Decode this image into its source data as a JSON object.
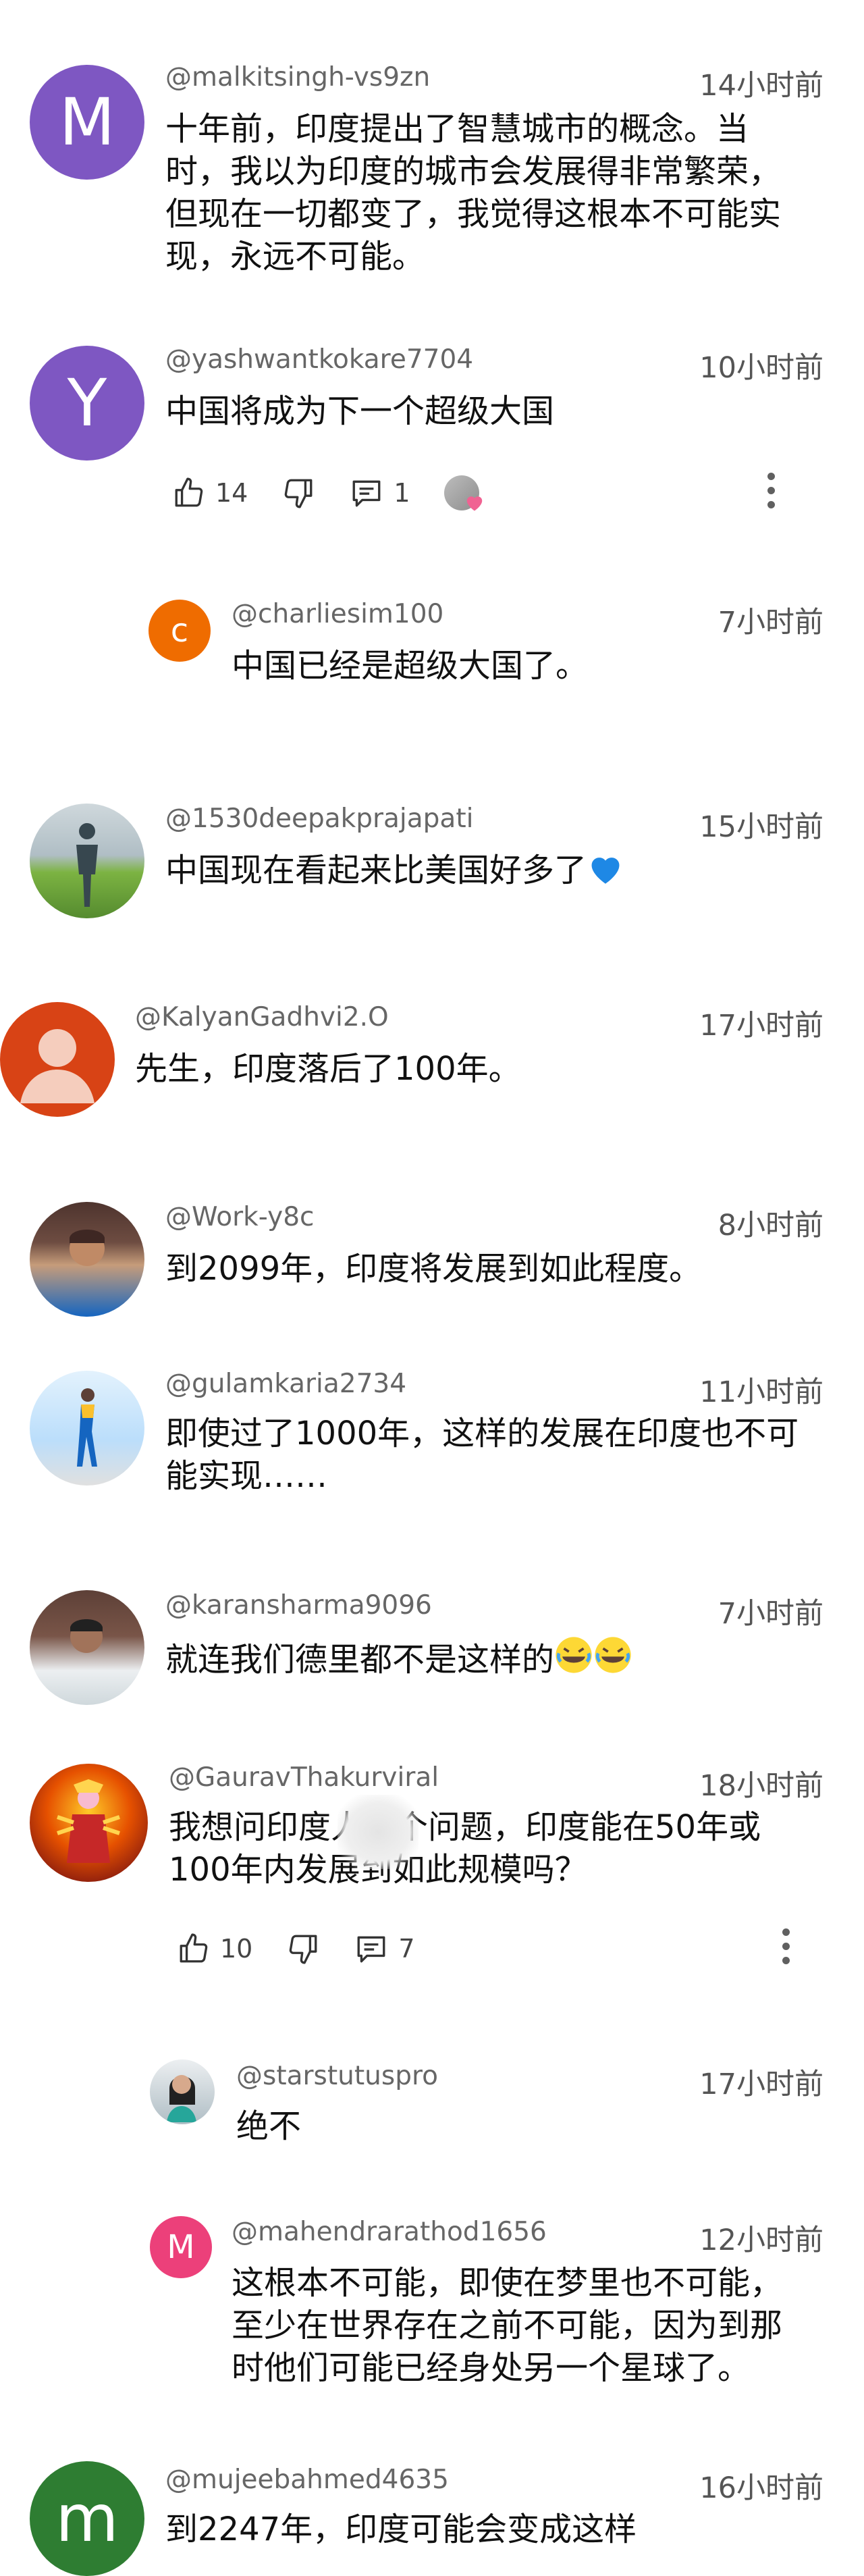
{
  "comments": [
    {
      "handle": "@malkitsingh-vs9zn",
      "time": "14小时前",
      "avatar_letter": "M",
      "avatar_color": "#7e57c2",
      "lines": [
        "十年前，印度提出了智慧城市的概念。当",
        "时，我以为印度的城市会发展得非常繁荣，",
        "但现在一切都变了，我觉得这根本不可能实",
        "现，永远不可能。"
      ]
    },
    {
      "handle": "@yashwantkokare7704",
      "time": "10小时前",
      "avatar_letter": "Y",
      "avatar_color": "#7e57c2",
      "lines": [
        "中国将成为下一个超级大国"
      ],
      "likes": "14",
      "replies": "1"
    },
    {
      "handle": "@charliesim100",
      "time": "7小时前",
      "avatar_letter": "c",
      "avatar_color": "#ef6c00",
      "lines": [
        "中国已经是超级大国了。"
      ]
    },
    {
      "handle": "@1530deepakprajapati",
      "time": "15小时前",
      "lines": [
        "中国现在看起来比美国好多了"
      ]
    },
    {
      "handle": "@KalyanGadhvi2.O",
      "time": "17小时前",
      "lines": [
        "先生，印度落后了100年。"
      ]
    },
    {
      "handle": "@Work-y8c",
      "time": "8小时前",
      "lines": [
        "到2099年，印度将发展到如此程度。"
      ]
    },
    {
      "handle": "@gulamkaria2734",
      "time": "11小时前",
      "lines": [
        "即使过了1000年，这样的发展在印度也不可",
        "能实现……"
      ]
    },
    {
      "handle": "@karansharma9096",
      "time": "7小时前",
      "lines": [
        "就连我们德里都不是这样的"
      ]
    },
    {
      "handle": "@GauravThakurviral",
      "time": "18小时前",
      "lines": [
        "我想问印度人一个问题，印度能在50年或",
        "100年内发展到如此规模吗？"
      ],
      "likes": "10",
      "replies": "7"
    },
    {
      "handle": "@starstutuspro",
      "time": "17小时前",
      "lines": [
        "绝不"
      ]
    },
    {
      "handle": "@mahendrarathod1656",
      "time": "12小时前",
      "avatar_letter": "M",
      "avatar_color": "#ec407a",
      "lines": [
        "这根本不可能，即使在梦里也不可能，",
        "至少在世界存在之前不可能，因为到那",
        "时他们可能已经身处另一个星球了。"
      ]
    },
    {
      "handle": "@mujeebahmed4635",
      "time": "16小时前",
      "avatar_letter": "m",
      "avatar_color": "#2e7d32",
      "lines": [
        "到2247年，印度可能会变成这样"
      ]
    }
  ]
}
